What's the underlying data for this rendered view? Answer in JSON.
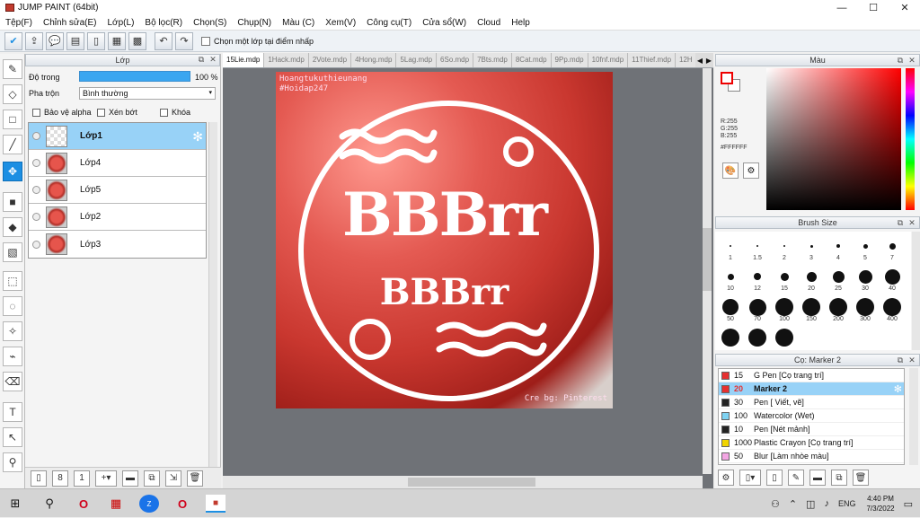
{
  "window": {
    "title": "JUMP PAINT (64bit)",
    "minimize": "—",
    "maximize": "☐",
    "close": "✕"
  },
  "menu": [
    "Tệp(F)",
    "Chỉnh sửa(E)",
    "Lớp(L)",
    "Bộ lọc(R)",
    "Chọn(S)",
    "Chụp(N)",
    "Màu (C)",
    "Xem(V)",
    "Công cụ(T)",
    "Cửa sổ(W)",
    "Cloud",
    "Help"
  ],
  "toolbar": {
    "select_layer_label": "Chọn một lớp tại điểm nhấp"
  },
  "layer_panel": {
    "title": "Lớp",
    "opacity_label": "Độ trong",
    "opacity_value": "100 %",
    "opacity_fraction": 1.0,
    "blend_label": "Pha trộn",
    "blend_value": "Bình thường",
    "protect_alpha": "Bảo vệ alpha",
    "clipping": "Xén bớt",
    "lock": "Khóa",
    "layers": [
      {
        "name": "Lớp1",
        "selected": true,
        "thumb": "transparent"
      },
      {
        "name": "Lớp4",
        "selected": false,
        "thumb": "melon"
      },
      {
        "name": "Lớp5",
        "selected": false,
        "thumb": "melon"
      },
      {
        "name": "Lớp2",
        "selected": false,
        "thumb": "melon"
      },
      {
        "name": "Lớp3",
        "selected": false,
        "thumb": "melon"
      }
    ]
  },
  "canvas": {
    "tabs": [
      "15Lie.mdp",
      "1Hack.mdp",
      "2Vote.mdp",
      "4Hong.mdp",
      "5Lag.mdp",
      "6So.mdp",
      "7Bts.mdp",
      "8Cat.mdp",
      "9Pp.mdp",
      "10fnf.mdp",
      "11Thief.mdp",
      "12H"
    ],
    "active_tab": 0,
    "art_main": "BBBrr",
    "art_sub": "BBBrr",
    "credit_line1": "Hoangtukuthieunang",
    "credit_line2": "#Hoidap247",
    "credit_bg": "Cre bg: Pinterest"
  },
  "color_panel": {
    "title": "Màu",
    "r": "R:255",
    "g": "G:255",
    "b": "B:255",
    "hex": "#FFFFFF"
  },
  "brush_panel": {
    "title": "Brush Size",
    "sizes": [
      "1",
      "1.5",
      "2",
      "3",
      "4",
      "5",
      "7",
      "10",
      "12",
      "15",
      "20",
      "25",
      "30",
      "40",
      "50",
      "70",
      "100",
      "150",
      "200",
      "300",
      "400",
      "",
      "",
      ""
    ]
  },
  "tool_panel": {
    "title": "Cọ: Marker 2",
    "tools": [
      {
        "size": "15",
        "name": "G Pen [Cọ trang trí]",
        "color": "#e63030",
        "selected": false
      },
      {
        "size": "20",
        "name": "Marker 2",
        "color": "#e63030",
        "selected": true
      },
      {
        "size": "30",
        "name": "Pen [ Viết, vẽ]",
        "color": "#222222",
        "selected": false
      },
      {
        "size": "100",
        "name": "Watercolor (Wet)",
        "color": "#7fd3f2",
        "selected": false
      },
      {
        "size": "10",
        "name": "Pen [Nét mảnh]",
        "color": "#222222",
        "selected": false
      },
      {
        "size": "1000",
        "name": "Plastic Crayon [Cọ trang trí]",
        "color": "#f0d400",
        "selected": false
      },
      {
        "size": "50",
        "name": "Blur [Làm nhòe màu]",
        "color": "#f3a6e3",
        "selected": false
      }
    ]
  },
  "taskbar": {
    "lang": "ENG",
    "time": "4:40 PM",
    "date": "7/3/2022"
  },
  "colors": {
    "accent": "#1c8fe3",
    "selected_row": "#98d2f7"
  }
}
